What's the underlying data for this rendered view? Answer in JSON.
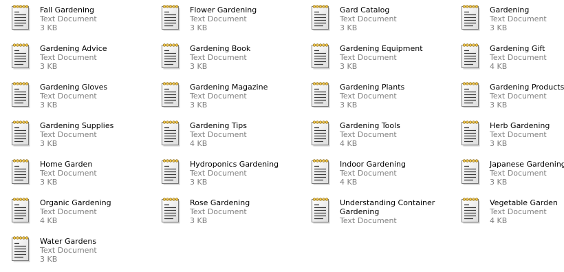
{
  "icon": "text-document-notepad-icon",
  "colors": {
    "name": "#000000",
    "meta": "#808080",
    "background": "#ffffff"
  },
  "files": [
    {
      "name": "Fall Gardening",
      "type": "Text Document",
      "size": "3 KB"
    },
    {
      "name": "Flower Gardening",
      "type": "Text Document",
      "size": "3 KB"
    },
    {
      "name": "Gard Catalog",
      "type": "Text Document",
      "size": "3 KB"
    },
    {
      "name": "Gardening",
      "type": "Text Document",
      "size": "3 KB"
    },
    {
      "name": "Gardening Advice",
      "type": "Text Document",
      "size": "3 KB"
    },
    {
      "name": "Gardening Book",
      "type": "Text Document",
      "size": "3 KB"
    },
    {
      "name": "Gardening Equipment",
      "type": "Text Document",
      "size": "3 KB"
    },
    {
      "name": "Gardening Gift",
      "type": "Text Document",
      "size": "4 KB"
    },
    {
      "name": "Gardening Gloves",
      "type": "Text Document",
      "size": "3 KB"
    },
    {
      "name": "Gardening Magazine",
      "type": "Text Document",
      "size": "3 KB"
    },
    {
      "name": "Gardening Plants",
      "type": "Text Document",
      "size": "3 KB"
    },
    {
      "name": "Gardening Products",
      "type": "Text Document",
      "size": "3 KB"
    },
    {
      "name": "Gardening Supplies",
      "type": "Text Document",
      "size": "3 KB"
    },
    {
      "name": "Gardening Tips",
      "type": "Text Document",
      "size": "4 KB"
    },
    {
      "name": "Gardening Tools",
      "type": "Text Document",
      "size": "4 KB"
    },
    {
      "name": "Herb Gardening",
      "type": "Text Document",
      "size": "3 KB"
    },
    {
      "name": "Home Garden",
      "type": "Text Document",
      "size": "3 KB"
    },
    {
      "name": "Hydroponics Gardening",
      "type": "Text Document",
      "size": "3 KB"
    },
    {
      "name": "Indoor Gardening",
      "type": "Text Document",
      "size": "4 KB"
    },
    {
      "name": "Japanese Gardening",
      "type": "Text Document",
      "size": "3 KB"
    },
    {
      "name": "Organic Gardening",
      "type": "Text Document",
      "size": "4 KB"
    },
    {
      "name": "Rose Gardening",
      "type": "Text Document",
      "size": "3 KB"
    },
    {
      "name": "Understanding Container Gardening",
      "type": "Text Document",
      "size": ""
    },
    {
      "name": "Vegetable Garden",
      "type": "Text Document",
      "size": "4 KB"
    },
    {
      "name": "Water Gardens",
      "type": "Text Document",
      "size": "3 KB"
    }
  ]
}
